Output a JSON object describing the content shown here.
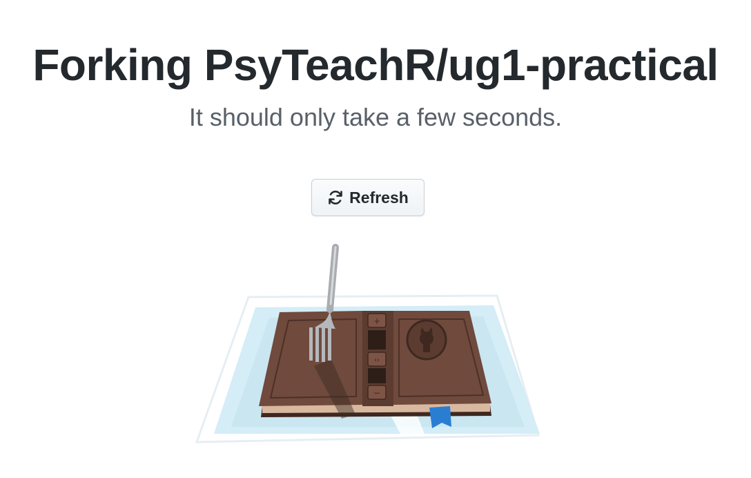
{
  "header": {
    "title": "Forking PsyTeachR/ug1-practical",
    "subtitle": "It should only take a few seconds."
  },
  "actions": {
    "refresh_label": "Refresh",
    "refresh_icon": "sync-icon"
  },
  "illustration": {
    "subject": "fork-in-book-illustration",
    "colors": {
      "book": "#6f4a3d",
      "book_dark": "#4c3026",
      "water": "#cfeaf6",
      "fork": "#a9acb0",
      "bookmark": "#2a7ed2"
    }
  }
}
